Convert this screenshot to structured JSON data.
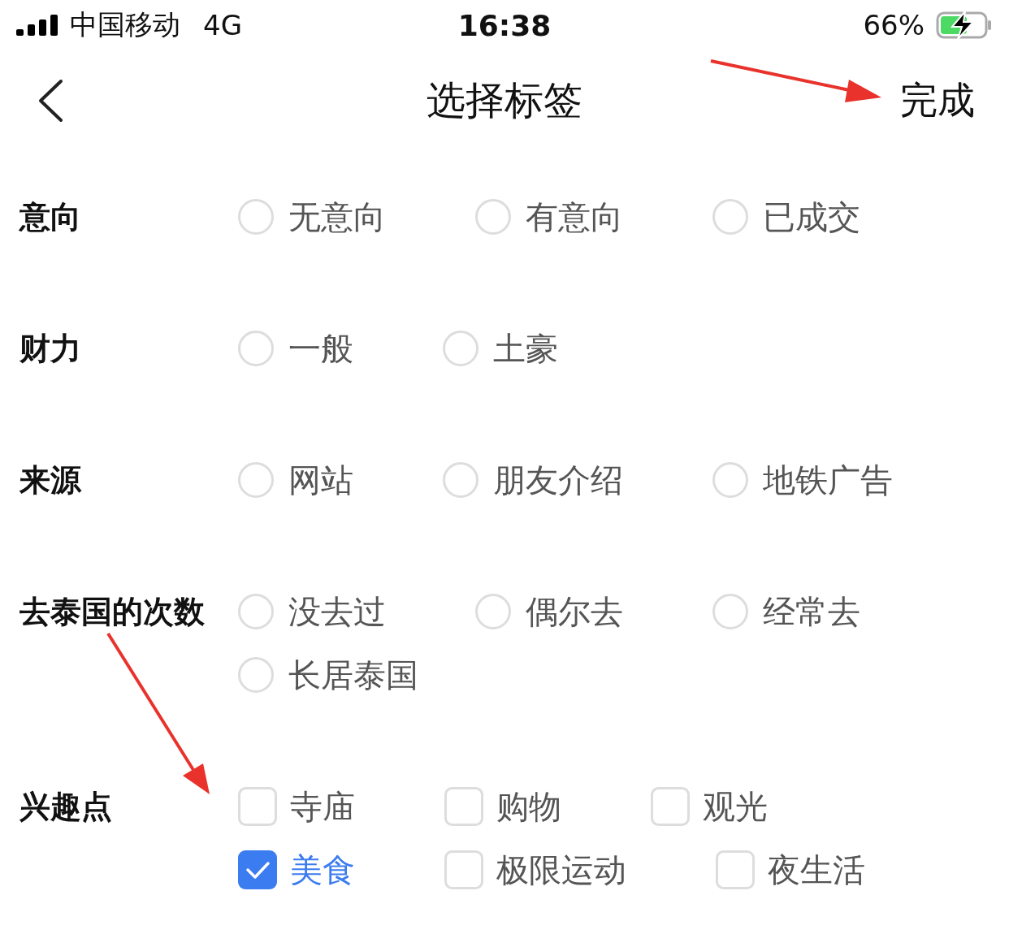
{
  "status_bar": {
    "carrier": "中国移动",
    "network": "4G",
    "time": "16:38",
    "battery": "66%"
  },
  "nav": {
    "title": "选择标签",
    "done": "完成"
  },
  "groups": [
    {
      "label": "意向",
      "kind": "radio",
      "options": [
        {
          "label": "无意向",
          "selected": false
        },
        {
          "label": "有意向",
          "selected": false
        },
        {
          "label": "已成交",
          "selected": false
        }
      ]
    },
    {
      "label": "财力",
      "kind": "radio",
      "options": [
        {
          "label": "一般",
          "selected": false
        },
        {
          "label": "土豪",
          "selected": false
        }
      ]
    },
    {
      "label": "来源",
      "kind": "radio",
      "options": [
        {
          "label": "网站",
          "selected": false
        },
        {
          "label": "朋友介绍",
          "selected": false
        },
        {
          "label": "地铁广告",
          "selected": false
        }
      ]
    },
    {
      "label": "去泰国的次数",
      "kind": "radio",
      "options": [
        {
          "label": "没去过",
          "selected": false
        },
        {
          "label": "偶尔去",
          "selected": false
        },
        {
          "label": "经常去",
          "selected": false
        },
        {
          "label": "长居泰国",
          "selected": false
        }
      ]
    },
    {
      "label": "兴趣点",
      "kind": "checkbox",
      "options": [
        {
          "label": "寺庙",
          "checked": false
        },
        {
          "label": "购物",
          "checked": false
        },
        {
          "label": "观光",
          "checked": false
        },
        {
          "label": "美食",
          "checked": true
        },
        {
          "label": "极限运动",
          "checked": false
        },
        {
          "label": "夜生活",
          "checked": false
        }
      ]
    }
  ]
}
